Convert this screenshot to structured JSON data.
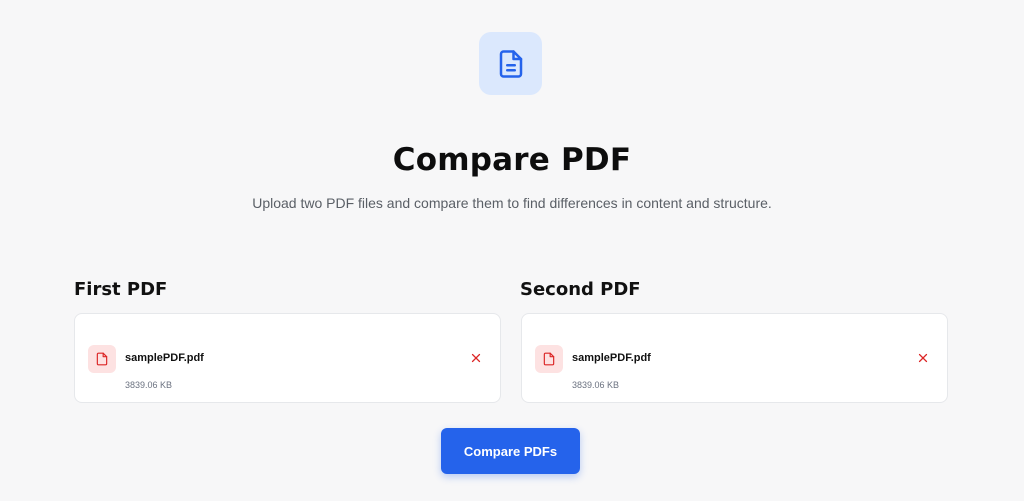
{
  "header": {
    "icon": "document-icon",
    "title": "Compare PDF",
    "subtitle": "Upload two PDF files and compare them to find differences in content and structure."
  },
  "first_pdf": {
    "label": "First PDF",
    "file_name": "samplePDF.pdf",
    "file_size": "3839.06 KB",
    "icon": "file-icon",
    "remove_icon": "close-icon"
  },
  "second_pdf": {
    "label": "Second PDF",
    "file_name": "samplePDF.pdf",
    "file_size": "3839.06 KB",
    "icon": "file-icon",
    "remove_icon": "close-icon"
  },
  "actions": {
    "compare_label": "Compare PDFs"
  },
  "colors": {
    "accent": "#2563eb",
    "icon_bg": "#dbe8fd",
    "file_icon_bg": "#fde2e2",
    "danger": "#dc2626",
    "background": "#f7f7f8"
  }
}
